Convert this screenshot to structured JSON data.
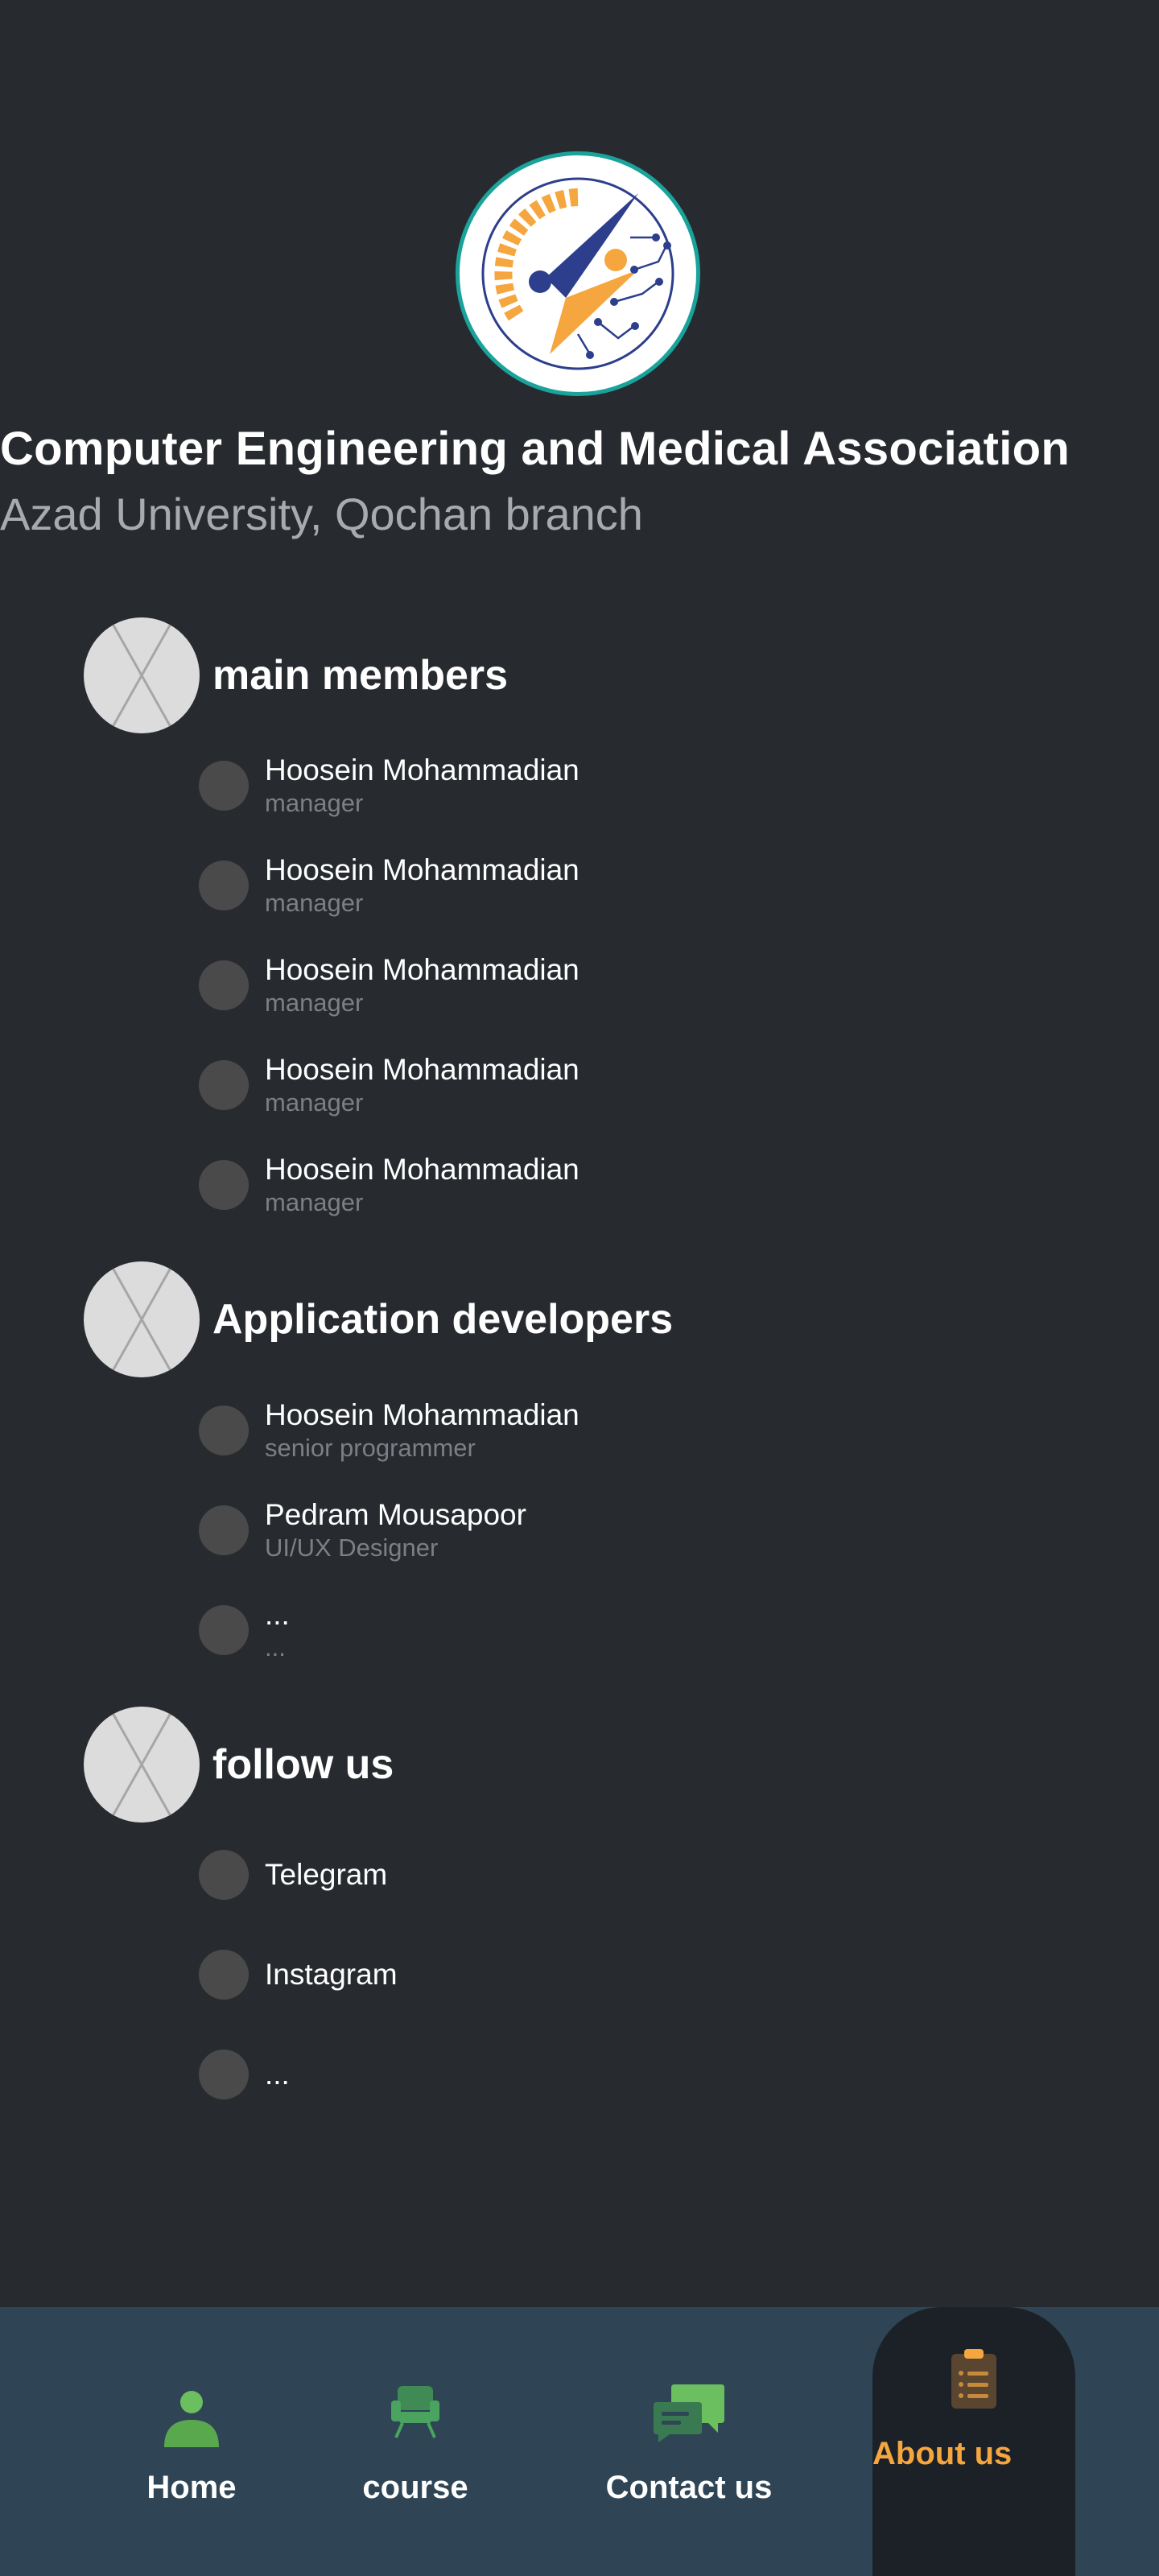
{
  "header": {
    "title": "Computer Engineering and Medical Association",
    "subtitle": "Azad University, Qochan branch"
  },
  "sections": [
    {
      "title": "main members",
      "items": [
        {
          "name": "Hoosein Mohammadian",
          "role": "manager"
        },
        {
          "name": "Hoosein Mohammadian",
          "role": "manager"
        },
        {
          "name": "Hoosein Mohammadian",
          "role": "manager"
        },
        {
          "name": "Hoosein Mohammadian",
          "role": "manager"
        },
        {
          "name": "Hoosein Mohammadian",
          "role": "manager"
        }
      ]
    },
    {
      "title": "Application developers",
      "items": [
        {
          "name": "Hoosein Mohammadian",
          "role": "senior programmer"
        },
        {
          "name": "Pedram Mousapoor",
          "role": "UI/UX Designer"
        },
        {
          "name": "...",
          "role": "..."
        }
      ]
    },
    {
      "title": "follow us",
      "items": [
        {
          "name": "Telegram"
        },
        {
          "name": "Instagram"
        },
        {
          "name": "..."
        }
      ]
    }
  ],
  "bottom_nav": {
    "items": [
      {
        "label": "Home",
        "icon": "person-icon"
      },
      {
        "label": "course",
        "icon": "armchair-icon"
      },
      {
        "label": "Contact us",
        "icon": "chat-bubbles-icon"
      },
      {
        "label": "About us",
        "icon": "clipboard-icon",
        "active": true
      }
    ]
  },
  "colors": {
    "background": "#272b30",
    "nav_background": "#2f4555",
    "active_tab": "#1b2127",
    "accent_orange": "#f5a63e",
    "accent_green": "#6cbf5f",
    "logo_ring": "#1aa39a"
  }
}
